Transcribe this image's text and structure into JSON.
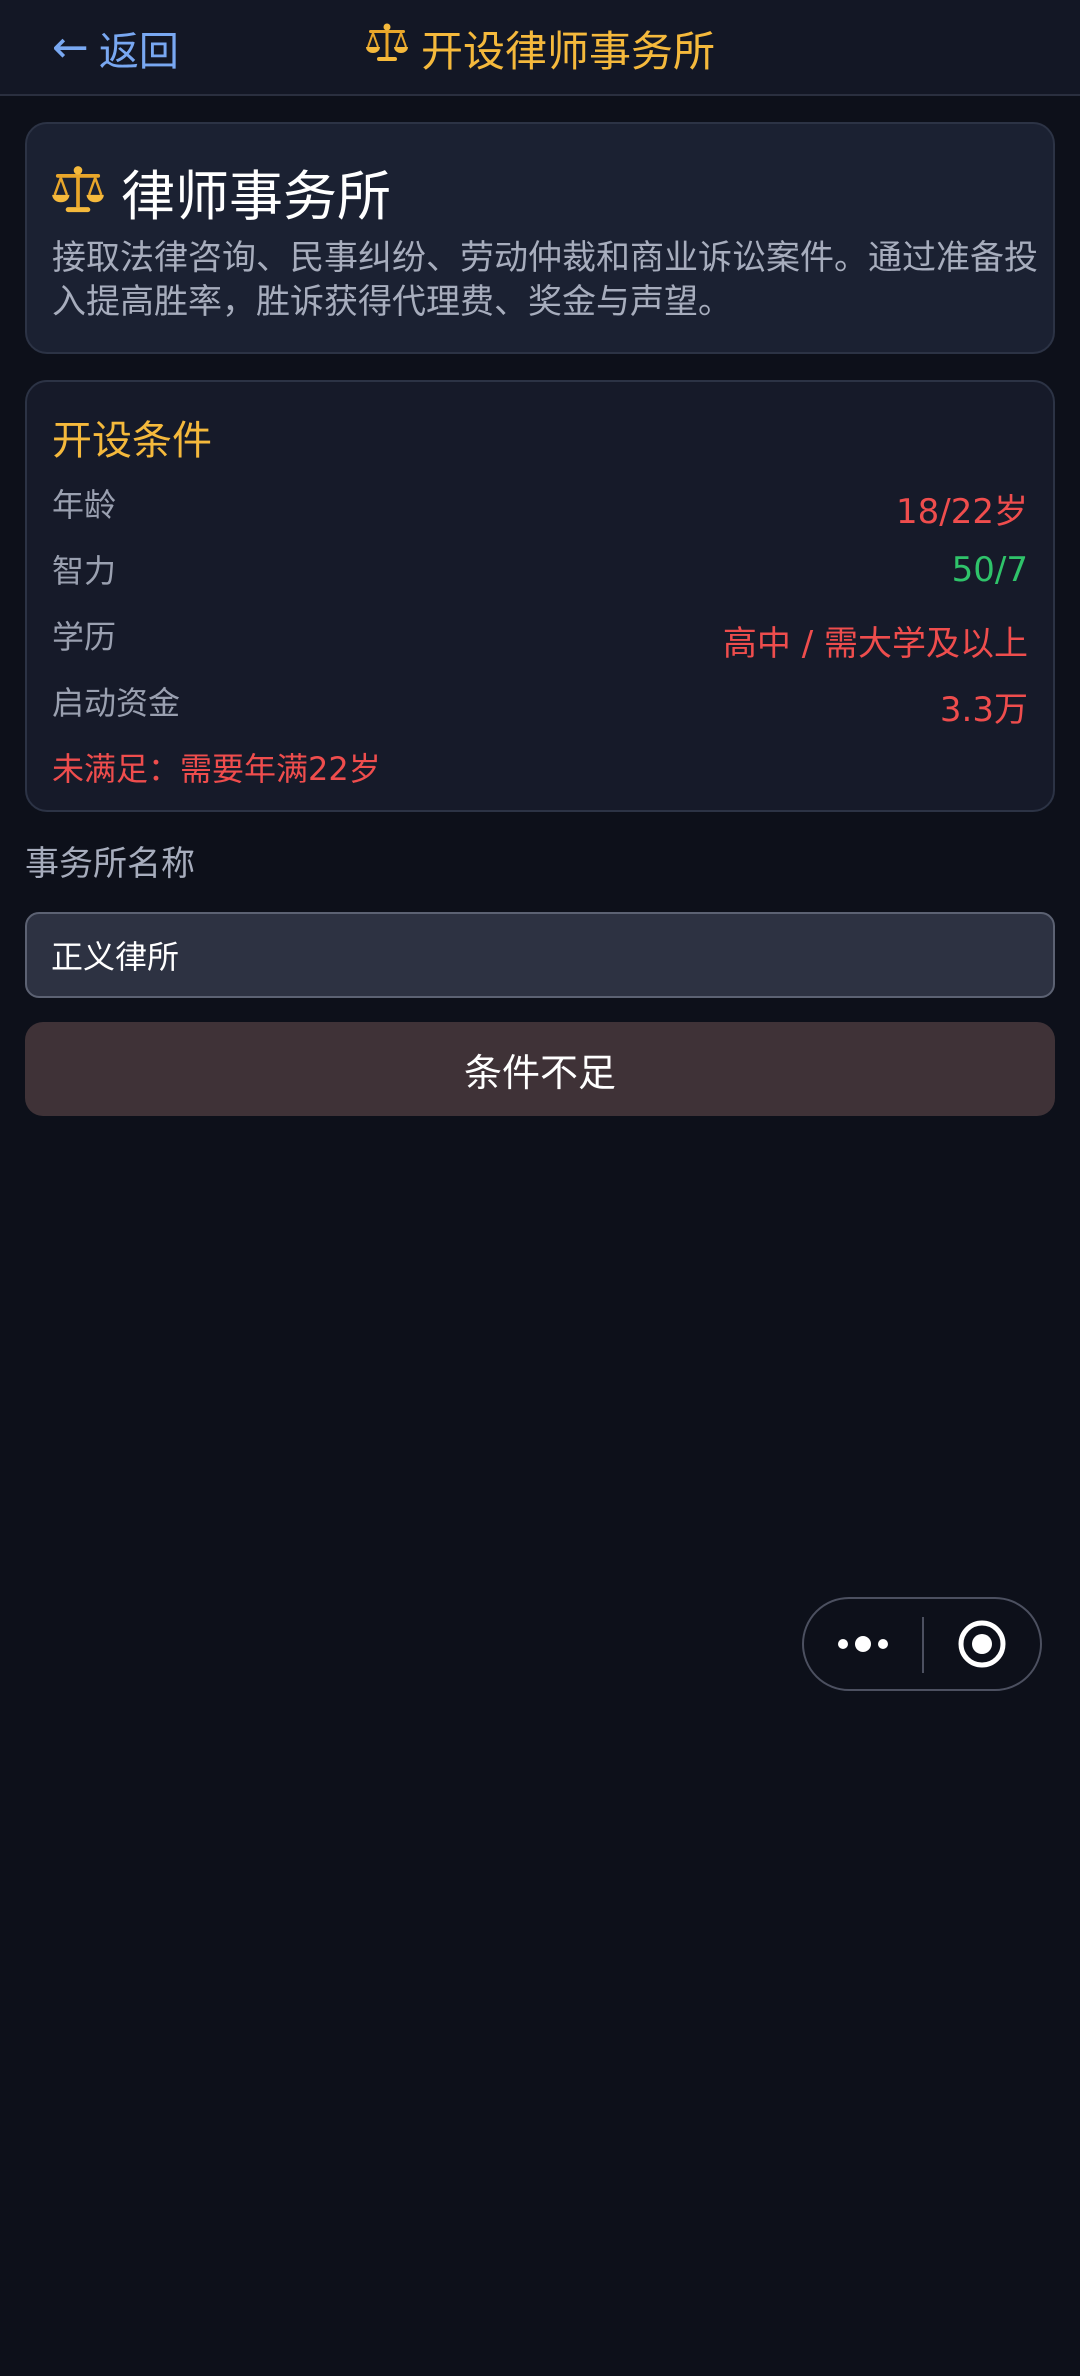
{
  "nav": {
    "back_label": "返回",
    "title": "开设律师事务所"
  },
  "intro": {
    "title": "律师事务所",
    "description": "接取法律咨询、民事纠纷、劳动仲裁和商业诉讼案件。通过准备投入提高胜率，胜诉获得代理费、奖金与声望。"
  },
  "requirements": {
    "title": "开设条件",
    "rows": [
      {
        "label": "年龄",
        "value": "18/22岁",
        "met": false
      },
      {
        "label": "智力",
        "value": "50/7",
        "met": true
      },
      {
        "label": "学历",
        "value": "高中 / 需大学及以上",
        "met": false
      },
      {
        "label": "启动资金",
        "value": "3.3万",
        "met": false
      }
    ],
    "warning": "未满足：需要年满22岁"
  },
  "form": {
    "name_label": "事务所名称",
    "name_value": "正义律所"
  },
  "submit": {
    "label": "条件不足",
    "enabled": false
  },
  "capsule": {
    "more_icon": "more-dots-icon",
    "close_icon": "target-close-icon"
  },
  "colors": {
    "background": "#0d101a",
    "accent": "#f5b93c",
    "link": "#79a8f2",
    "unmet": "#ef4d4d",
    "met": "#2fc36a",
    "button_disabled": "#3f3237"
  }
}
